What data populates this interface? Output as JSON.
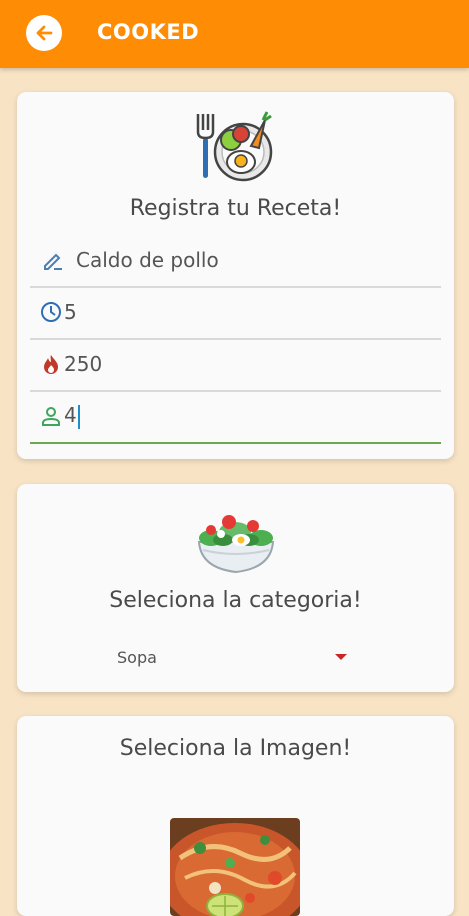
{
  "appbar": {
    "title": "COOKED",
    "back_icon": "arrow-left-icon",
    "color": "#fe8c05"
  },
  "recipe_card": {
    "icon": "plate-fork-food-icon",
    "title": "Registra tu Receta!",
    "fields": [
      {
        "icon": "pencil-icon",
        "value": "Caldo de pollo"
      },
      {
        "icon": "clock-icon",
        "value": "5"
      },
      {
        "icon": "flame-icon",
        "value": "250"
      },
      {
        "icon": "person-icon",
        "value": "4"
      }
    ]
  },
  "category_card": {
    "icon": "salad-bowl-icon",
    "title": "Seleciona la categoria!",
    "dropdown": {
      "selected": "Sopa"
    }
  },
  "image_card": {
    "title": "Seleciona la Imagen!",
    "image": "soup-photo"
  }
}
